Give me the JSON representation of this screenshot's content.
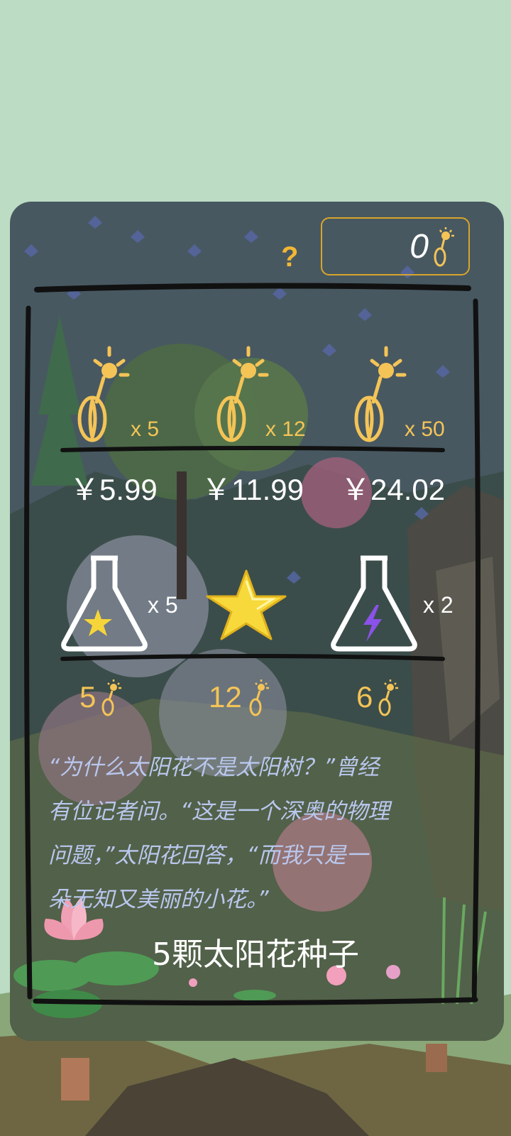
{
  "header": {
    "help_label": "?",
    "seed_count": "0"
  },
  "seed_packs": [
    {
      "qty": "x 5",
      "price": "￥5.99"
    },
    {
      "qty": "x 12",
      "price": "￥11.99"
    },
    {
      "qty": "x 50",
      "price": "￥24.02"
    }
  ],
  "items": [
    {
      "name": "star-potion-icon",
      "qty": "x 5",
      "cost": "5"
    },
    {
      "name": "gold-star-icon",
      "qty": "",
      "cost": "12"
    },
    {
      "name": "lightning-potion-icon",
      "qty": "x 2",
      "cost": "6"
    }
  ],
  "description": {
    "line1": "“为什么太阳花不是太阳树？”曾经",
    "line2": "有位记者问。“这是一个深奥的物理",
    "line3": "问题，”太阳花回答，“而我只是一",
    "line4": "朵无知又美丽的小花。”"
  },
  "caption": "5颗太阳花种子",
  "colors": {
    "accent": "#f4c457",
    "panel": "#344250",
    "text": "#ffffff"
  }
}
